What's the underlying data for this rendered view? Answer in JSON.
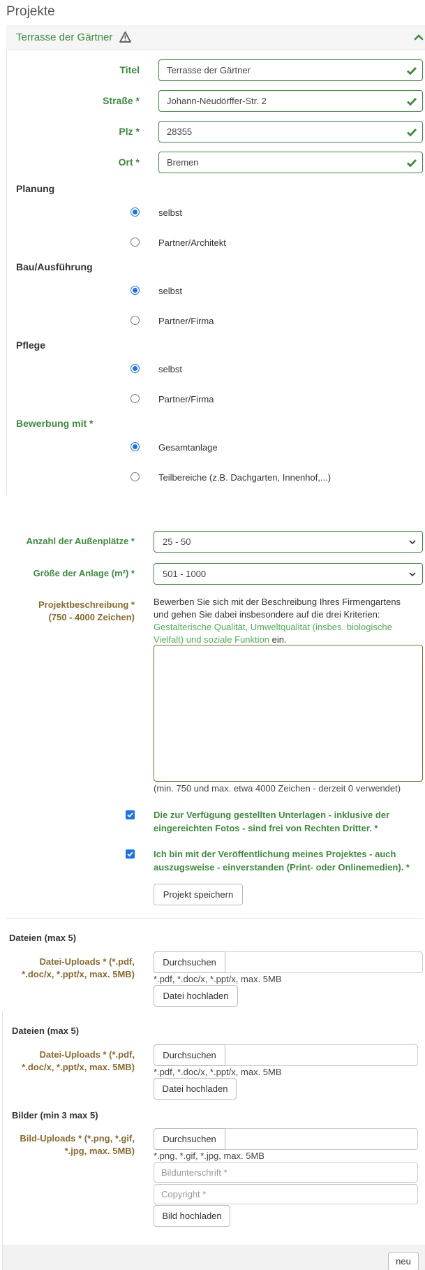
{
  "page": {
    "title": "Projekte"
  },
  "panel": {
    "title": "Terrasse der Gärtner",
    "warning_icon": "warning-triangle-icon",
    "collapse_icon": "chevron-up-icon"
  },
  "fields": {
    "titel": {
      "label": "Titel",
      "value": "Terrasse der Gärtner"
    },
    "strasse": {
      "label": "Straße *",
      "value": "Johann-Neudörffer-Str. 2"
    },
    "plz": {
      "label": "Plz *",
      "value": "28355"
    },
    "ort": {
      "label": "Ort *",
      "value": "Bremen"
    }
  },
  "groups": {
    "planung": {
      "label": "Planung",
      "opt1": "selbst",
      "opt2": "Partner/Architekt",
      "selected": "selbst"
    },
    "bau": {
      "label": "Bau/Ausführung",
      "opt1": "selbst",
      "opt2": "Partner/Firma",
      "selected": "selbst"
    },
    "pflege": {
      "label": "Pflege",
      "opt1": "selbst",
      "opt2": "Partner/Firma",
      "selected": "selbst"
    },
    "bewerbung": {
      "label": "Bewerbung mit *",
      "opt1": "Gesamtanlage",
      "opt2": "Teilbereiche (z.B. Dachgarten, Innenhof,...)",
      "selected": "Gesamtanlage"
    }
  },
  "selects": {
    "aussenplaetze": {
      "label": "Anzahl der Außenplätze *",
      "value": "25 - 50"
    },
    "groesse": {
      "label": "Größe der Anlage (m²) *",
      "value": "501 - 1000"
    }
  },
  "beschreibung": {
    "label_line1": "Projektbeschreibung *",
    "label_line2": "(750 - 4000 Zeichen)",
    "intro_line1": "Bewerben Sie sich mit der Beschreibung Ihres Firmengartens",
    "intro_line2": "und gehen Sie dabei insbesondere auf die drei Kriterien:",
    "link1": "Gestalterische Qualität",
    "sep1": ", ",
    "link2_line1": "Umweltqualität (insbes. biologische",
    "link2_line2": "Vielfalt)",
    "sep2": " und ",
    "link3": "soziale Funktion",
    "suffix": " ein.",
    "value": "",
    "counter": "(min. 750 und max. etwa 4000 Zeichen - derzeit 0 verwendet)"
  },
  "checkboxes": {
    "rechte_line1": "Die zur Verfügung gestellten Unterlagen - inklusive der",
    "rechte_line2": "eingereichten Fotos - sind frei von Rechten Dritter. *",
    "veroeff_line1": "Ich bin mit der Veröffentlichung meines Projektes - auch",
    "veroeff_line2": "auszugsweise - einverstanden (Print- oder Onlinemedien). *"
  },
  "save_button": "Projekt speichern",
  "uploads1": {
    "heading": "Dateien (max 5)",
    "label_line1": "Datei-Uploads * (*.pdf,",
    "label_line2": "*.doc/x, *.ppt/x, max. 5MB)",
    "browse": "Durchsuchen",
    "hint": "*.pdf, *.doc/x, *.ppt/x, max. 5MB",
    "button": "Datei hochladen"
  },
  "uploads2": {
    "heading": "Dateien (max 5)",
    "label_line1": "Datei-Uploads * (*.pdf,",
    "label_line2": "*.doc/x, *.ppt/x, max. 5MB)",
    "browse": "Durchsuchen",
    "hint": "*.pdf, *.doc/x, *.ppt/x, max. 5MB",
    "button": "Datei hochladen"
  },
  "bilder": {
    "heading": "Bilder (min 3 max 5)",
    "label_line1": "Bild-Uploads * (*.png, *.gif,",
    "label_line2": "*.jpg, max. 5MB)",
    "browse": "Durchsuchen",
    "hint": "*.png, *.gif, *.jpg, max. 5MB",
    "caption_placeholder": "Bildunterschrift *",
    "copyright_placeholder": "Copyright *",
    "button": "Bild hochladen"
  },
  "footer": {
    "new_button": "neu"
  },
  "colors": {
    "accent_green": "#3d8b3d",
    "label_olive": "#8a6a2f",
    "radio_blue": "#1a73e8"
  }
}
